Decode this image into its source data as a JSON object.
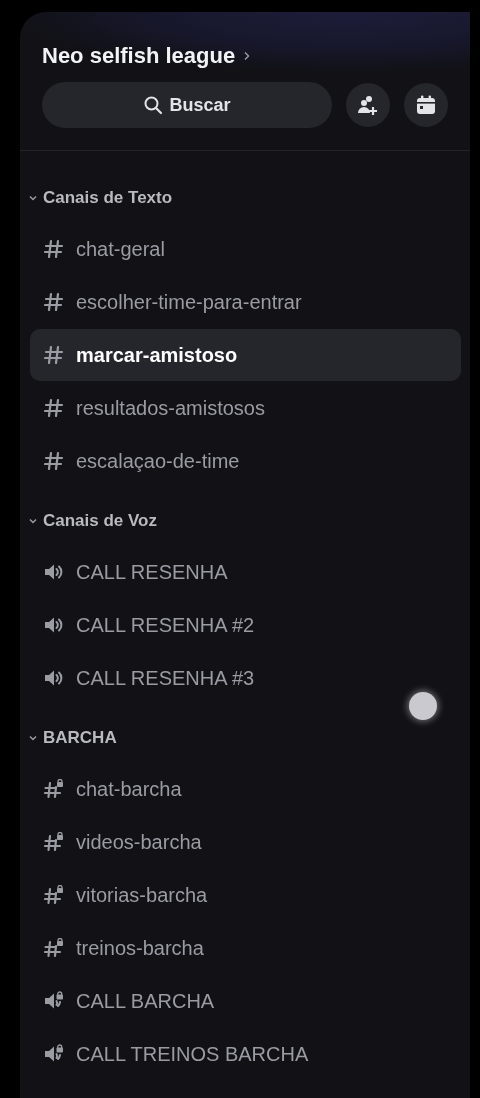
{
  "server": {
    "name": "Neo selfish league"
  },
  "search": {
    "label": "Buscar"
  },
  "categories": [
    {
      "name": "Canais de Texto",
      "expanded": true,
      "channels": [
        {
          "name": "chat-geral",
          "kind": "text",
          "selected": false
        },
        {
          "name": "escolher-time-para-entrar",
          "kind": "text",
          "selected": false
        },
        {
          "name": "marcar-amistoso",
          "kind": "text",
          "selected": true
        },
        {
          "name": "resultados-amistosos",
          "kind": "text",
          "selected": false
        },
        {
          "name": "escalaçao-de-time",
          "kind": "text",
          "selected": false
        }
      ]
    },
    {
      "name": "Canais de Voz",
      "expanded": true,
      "channels": [
        {
          "name": "CALL RESENHA",
          "kind": "voice",
          "selected": false
        },
        {
          "name": "CALL RESENHA #2",
          "kind": "voice",
          "selected": false
        },
        {
          "name": "CALL RESENHA #3",
          "kind": "voice",
          "selected": false
        }
      ]
    },
    {
      "name": "BARCHA",
      "expanded": true,
      "channels": [
        {
          "name": "chat-barcha",
          "kind": "locked-text",
          "selected": false
        },
        {
          "name": "videos-barcha",
          "kind": "locked-text",
          "selected": false
        },
        {
          "name": "vitorias-barcha",
          "kind": "locked-text",
          "selected": false
        },
        {
          "name": "treinos-barcha",
          "kind": "locked-text",
          "selected": false
        },
        {
          "name": "CALL BARCHA",
          "kind": "locked-voice",
          "selected": false
        },
        {
          "name": "CALL TREINOS BARCHA",
          "kind": "locked-voice",
          "selected": false
        }
      ]
    }
  ]
}
